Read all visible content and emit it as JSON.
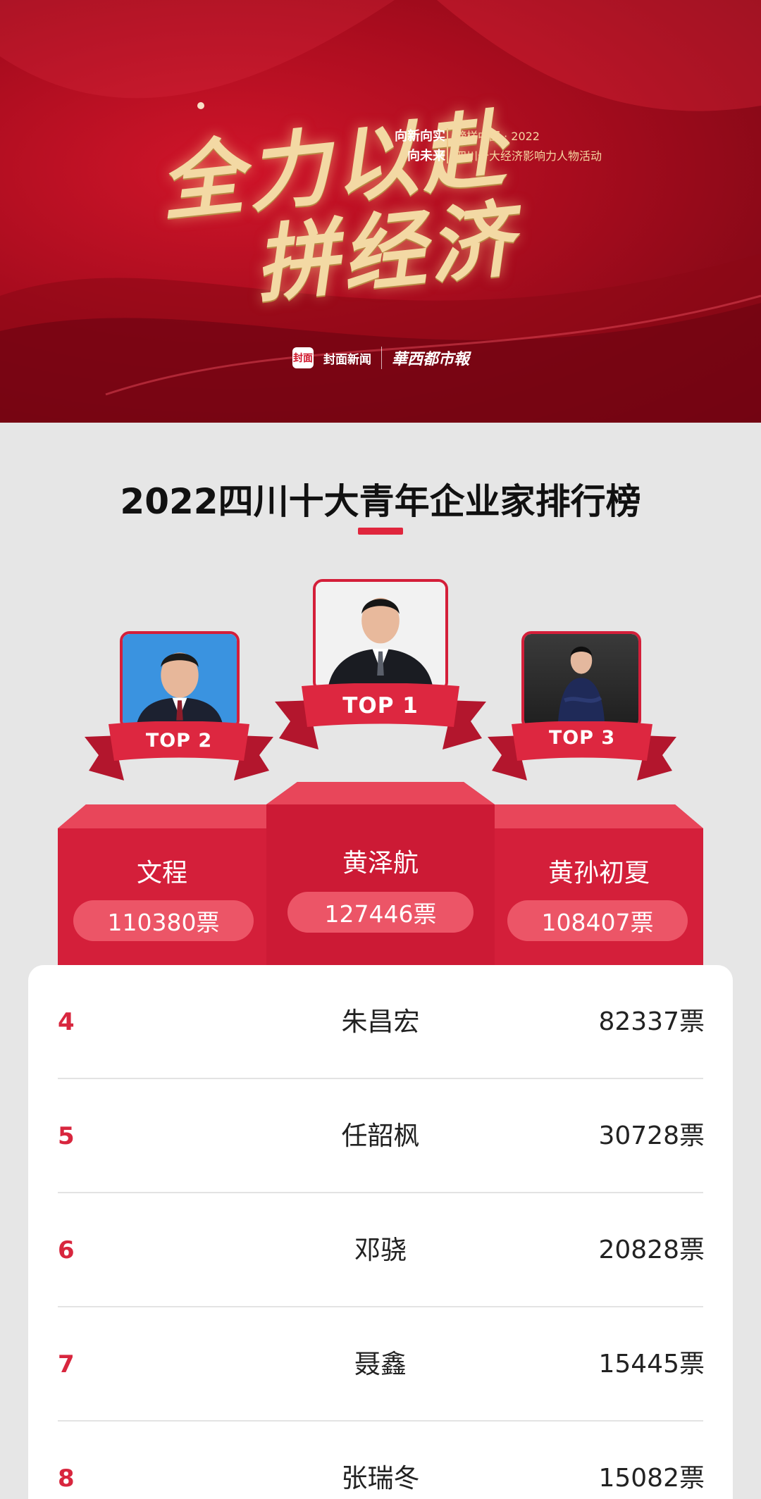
{
  "banner": {
    "calligraphy_line1": "全力以赴",
    "calligraphy_line2": "拼经济",
    "slogan_line1": "向新向实",
    "slogan_line2": "向未来",
    "campaign_line1": "榜样中国 · 2022",
    "campaign_line2": "四川十大经济影响力人物活动",
    "logo1_badge": "封面",
    "logo1_text": "封面新闻",
    "logo2_text": "華西都市報"
  },
  "title": "2022四川十大青年企业家排行榜",
  "top3": [
    {
      "rank_label": "TOP 1",
      "name": "黄泽航",
      "votes": "127446票"
    },
    {
      "rank_label": "TOP 2",
      "name": "文程",
      "votes": "110380票"
    },
    {
      "rank_label": "TOP 3",
      "name": "黄孙初夏",
      "votes": "108407票"
    }
  ],
  "list": [
    {
      "rank": "4",
      "name": "朱昌宏",
      "votes": "82337票"
    },
    {
      "rank": "5",
      "name": "任韶枫",
      "votes": "30728票"
    },
    {
      "rank": "6",
      "name": "邓骁",
      "votes": "20828票"
    },
    {
      "rank": "7",
      "name": "聂鑫",
      "votes": "15445票"
    },
    {
      "rank": "8",
      "name": "张瑞冬",
      "votes": "15082票"
    }
  ],
  "colors": {
    "accent": "#e0263d",
    "podium": "#d41f3a",
    "vote_pill": "#ec5567",
    "banner_red": "#b80f22",
    "gold": "#f3d9a4"
  }
}
